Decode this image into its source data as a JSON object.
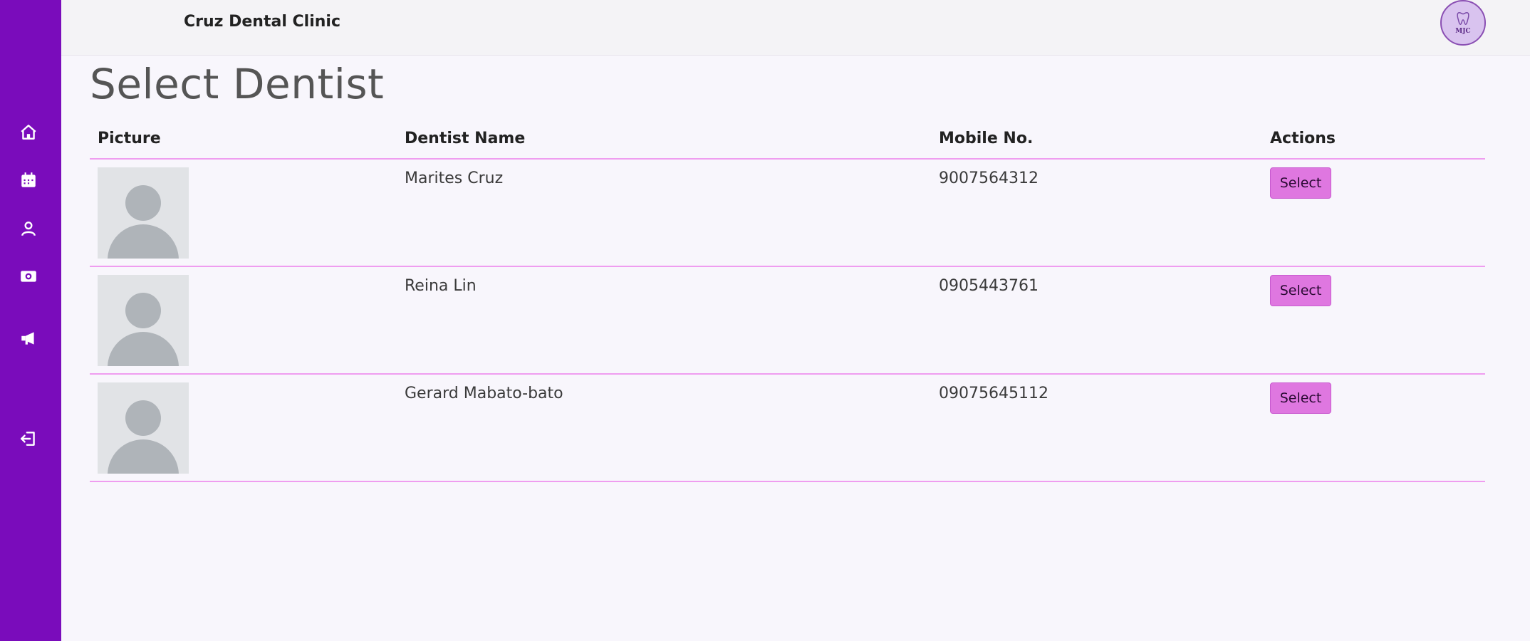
{
  "app": {
    "clinic_name": "Cruz Dental Clinic",
    "logo_text": "MJC"
  },
  "sidebar": {
    "items": [
      {
        "icon": "home-icon"
      },
      {
        "icon": "calendar-icon"
      },
      {
        "icon": "user-icon"
      },
      {
        "icon": "money-icon"
      },
      {
        "icon": "megaphone-icon"
      },
      {
        "icon": "logout-icon"
      }
    ]
  },
  "page": {
    "title": "Select Dentist"
  },
  "table": {
    "headers": {
      "picture": "Picture",
      "name": "Dentist Name",
      "mobile": "Mobile No.",
      "actions": "Actions"
    },
    "rows": [
      {
        "name": "Marites Cruz",
        "mobile": "9007564312",
        "action": "Select"
      },
      {
        "name": "Reina Lin",
        "mobile": "0905443761",
        "action": "Select"
      },
      {
        "name": "Gerard Mabato-bato",
        "mobile": "09075645112",
        "action": "Select"
      }
    ]
  },
  "colors": {
    "sidebar": "#7a0cbb",
    "accent": "#df77e0",
    "divider": "#ef9df0"
  }
}
